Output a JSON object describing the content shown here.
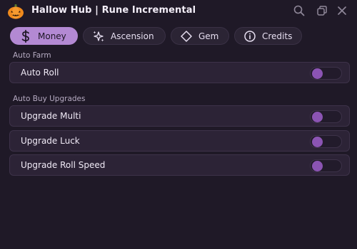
{
  "window": {
    "title": "Hallow Hub | Rune Incremental",
    "logo_icon": "pumpkin-icon",
    "controls": [
      "search-icon",
      "restore-icon",
      "close-icon"
    ]
  },
  "tabs": [
    {
      "label": "Money",
      "icon": "dollar-icon",
      "active": true
    },
    {
      "label": "Ascension",
      "icon": "sparkles-icon",
      "active": false
    },
    {
      "label": "Gem",
      "icon": "diamond-icon",
      "active": false
    },
    {
      "label": "Credits",
      "icon": "info-icon",
      "active": false
    }
  ],
  "sections": [
    {
      "title": "Auto Farm",
      "toggles": [
        {
          "label": "Auto Roll",
          "on": false
        }
      ]
    },
    {
      "title": "Auto Buy Upgrades",
      "toggles": [
        {
          "label": "Upgrade Multi",
          "on": false
        },
        {
          "label": "Upgrade Luck",
          "on": false
        },
        {
          "label": "Upgrade Roll Speed",
          "on": false
        }
      ]
    }
  ],
  "colors": {
    "background": "#1f1927",
    "accent": "#b389d3",
    "toggle_knob": "#8b54b3",
    "row_bg": "#2c2336"
  }
}
